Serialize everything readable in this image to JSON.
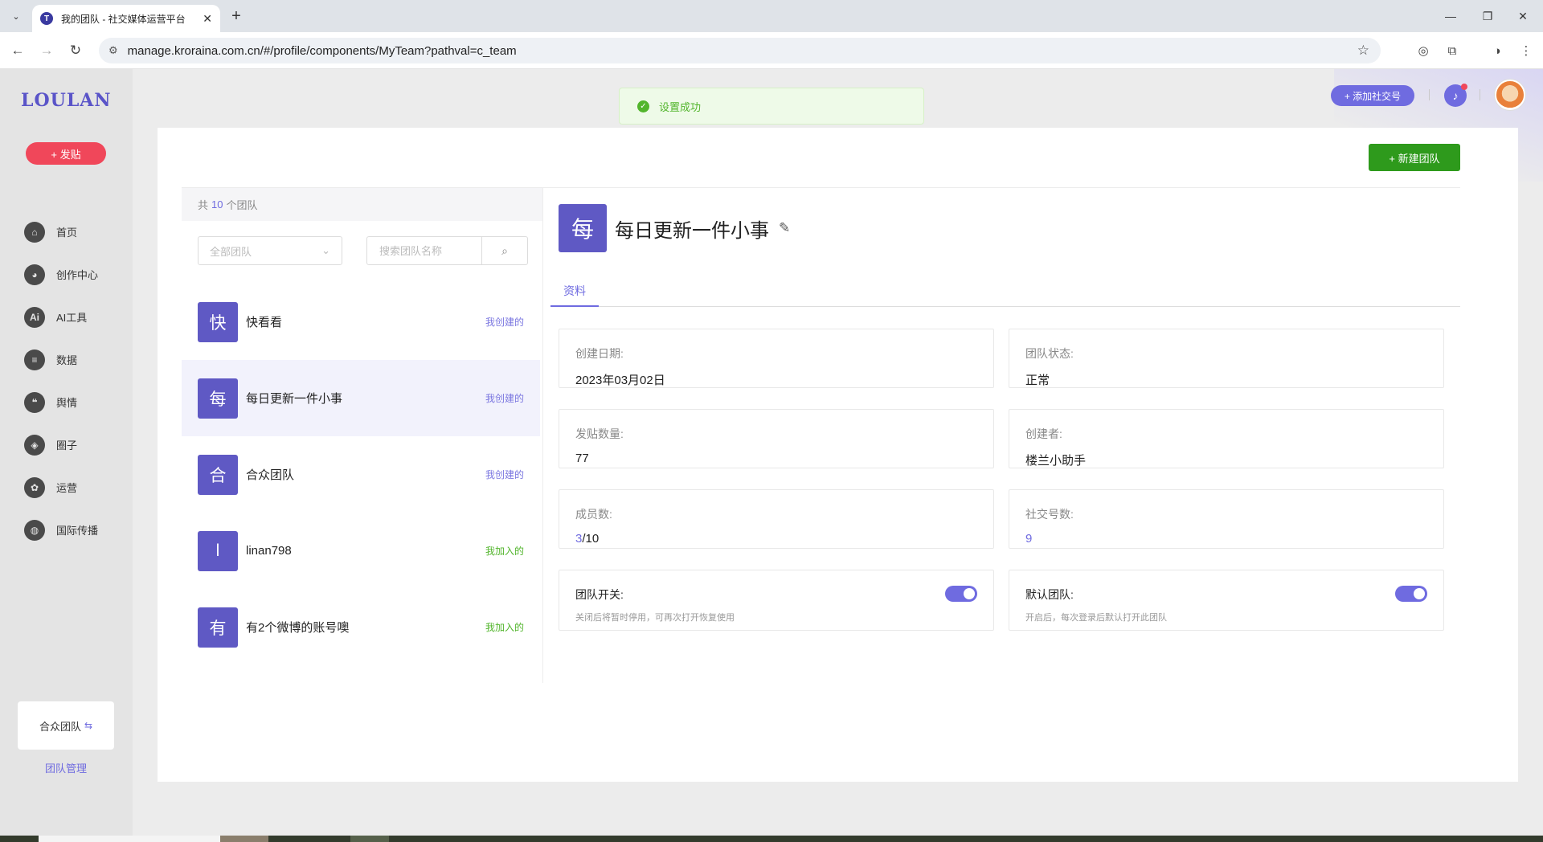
{
  "browser": {
    "tab_title": "我的团队 - 社交媒体运营平台",
    "favicon_letter": "T",
    "url": "manage.kroraina.com.cn/#/profile/components/MyTeam?pathval=c_team"
  },
  "sidebar": {
    "logo": "LOULAN",
    "post_button": "+ 发贴",
    "items": [
      {
        "label": "首页",
        "icon": "home-icon",
        "glyph": "⌂"
      },
      {
        "label": "创作中心",
        "icon": "palette-icon",
        "glyph": "◕"
      },
      {
        "label": "AI工具",
        "icon": "ai-icon",
        "glyph": "Ai"
      },
      {
        "label": "数据",
        "icon": "database-icon",
        "glyph": "≡"
      },
      {
        "label": "舆情",
        "icon": "quote-icon",
        "glyph": "❝"
      },
      {
        "label": "圈子",
        "icon": "compass-icon",
        "glyph": "◈"
      },
      {
        "label": "运营",
        "icon": "operation-icon",
        "glyph": "✿"
      },
      {
        "label": "国际传播",
        "icon": "globe-icon",
        "glyph": "◍"
      }
    ],
    "current_team": "合众团队",
    "team_manage": "团队管理"
  },
  "header": {
    "add_social": "+ 添加社交号"
  },
  "toast": {
    "message": "设置成功"
  },
  "main": {
    "new_team_button": "+ 新建团队",
    "count_prefix": "共",
    "count": "10",
    "count_suffix": "个团队",
    "filter_placeholder": "全部团队",
    "search_placeholder": "搜索团队名称",
    "teams": [
      {
        "initial": "快",
        "name": "快看看",
        "tag": "我创建的",
        "type": "created"
      },
      {
        "initial": "每",
        "name": "每日更新一件小事",
        "tag": "我创建的",
        "type": "created"
      },
      {
        "initial": "合",
        "name": "合众团队",
        "tag": "我创建的",
        "type": "created"
      },
      {
        "initial": "l",
        "name": "linan798",
        "tag": "我加入的",
        "type": "joined"
      },
      {
        "initial": "有",
        "name": "有2个微博的账号噢",
        "tag": "我加入的",
        "type": "joined"
      }
    ],
    "detail": {
      "initial": "每",
      "title": "每日更新一件小事",
      "tab": "资料",
      "created_date_label": "创建日期:",
      "created_date": "2023年03月02日",
      "status_label": "团队状态:",
      "status": "正常",
      "posts_label": "发贴数量:",
      "posts": "77",
      "creator_label": "创建者:",
      "creator": "楼兰小助手",
      "members_label": "成员数:",
      "members_current": "3",
      "members_max": "/10",
      "social_label": "社交号数:",
      "social_count": "9",
      "team_switch_label": "团队开关:",
      "team_switch_desc": "关闭后将暂时停用，可再次打开恢复使用",
      "team_switch_on": true,
      "default_label": "默认团队:",
      "default_desc": "开启后，每次登录后默认打开此团队",
      "default_on": true
    }
  },
  "colors": {
    "accent": "#6f6be0",
    "badge": "#5f59c4",
    "danger": "#f0475a",
    "success": "#2e9a1c"
  }
}
